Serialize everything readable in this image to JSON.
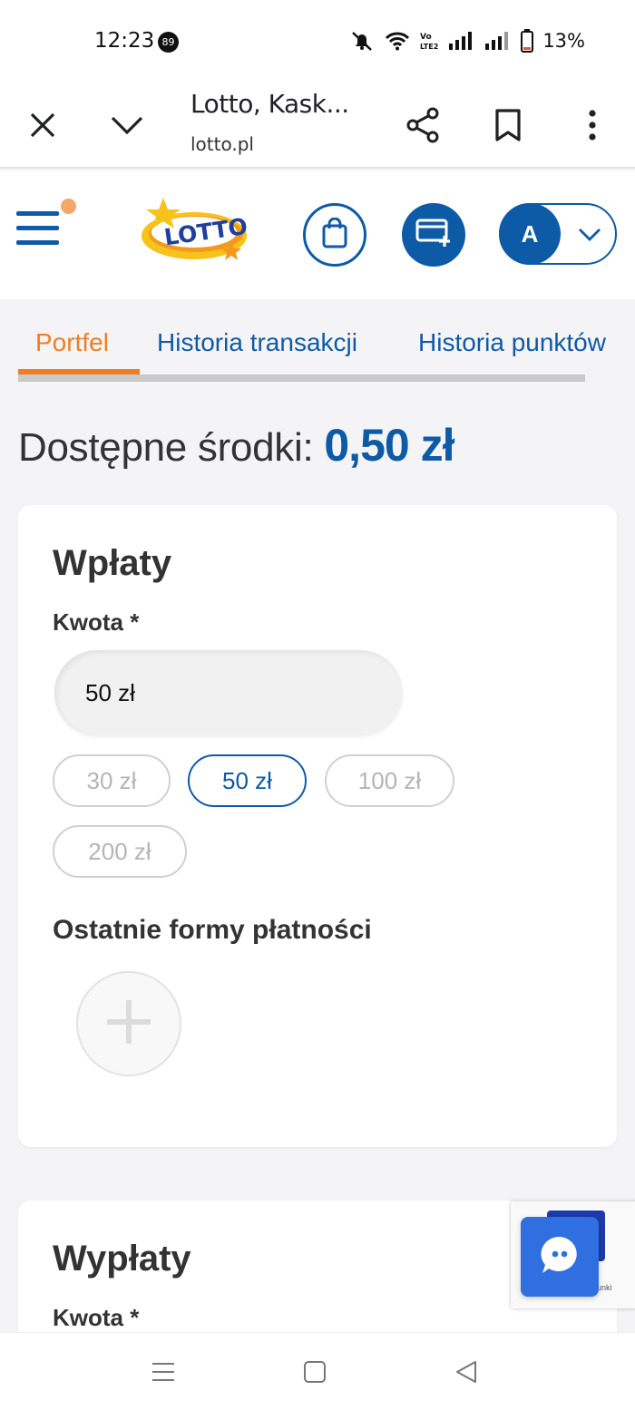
{
  "status_bar": {
    "time": "12:23",
    "notification_count": "89",
    "battery": "13%",
    "network_label": "Vo LTE2"
  },
  "browser": {
    "title": "Lotto, Kask...",
    "url": "lotto.pl",
    "icons": [
      "close-icon",
      "chevron-down-icon",
      "share-icon",
      "bookmark-icon",
      "more-vert-icon"
    ]
  },
  "header": {
    "logo_text": "LOTTO",
    "avatar_initial": "A",
    "colors": {
      "brand_blue": "#0d5aa7",
      "accent_orange": "#ef7d22",
      "logo_yellow": "#f7c21a"
    }
  },
  "tabs": [
    {
      "label": "Portfel",
      "active": true
    },
    {
      "label": "Historia transakcji",
      "active": false
    },
    {
      "label": "Historia punktów",
      "active": false
    }
  ],
  "balance": {
    "label": "Dostępne środki:",
    "amount": "0,50 zł"
  },
  "deposit": {
    "title": "Wpłaty",
    "amount_label": "Kwota *",
    "amount_value": "50 zł",
    "presets": [
      {
        "label": "30 zł",
        "selected": false
      },
      {
        "label": "50 zł",
        "selected": true
      },
      {
        "label": "100 zł",
        "selected": false
      },
      {
        "label": "200 zł",
        "selected": false
      }
    ],
    "recent_methods_label": "Ostatnie formy płatności"
  },
  "withdraw": {
    "title": "Wypłaty",
    "amount_label": "Kwota *"
  },
  "recaptcha": {
    "text": "runki"
  }
}
